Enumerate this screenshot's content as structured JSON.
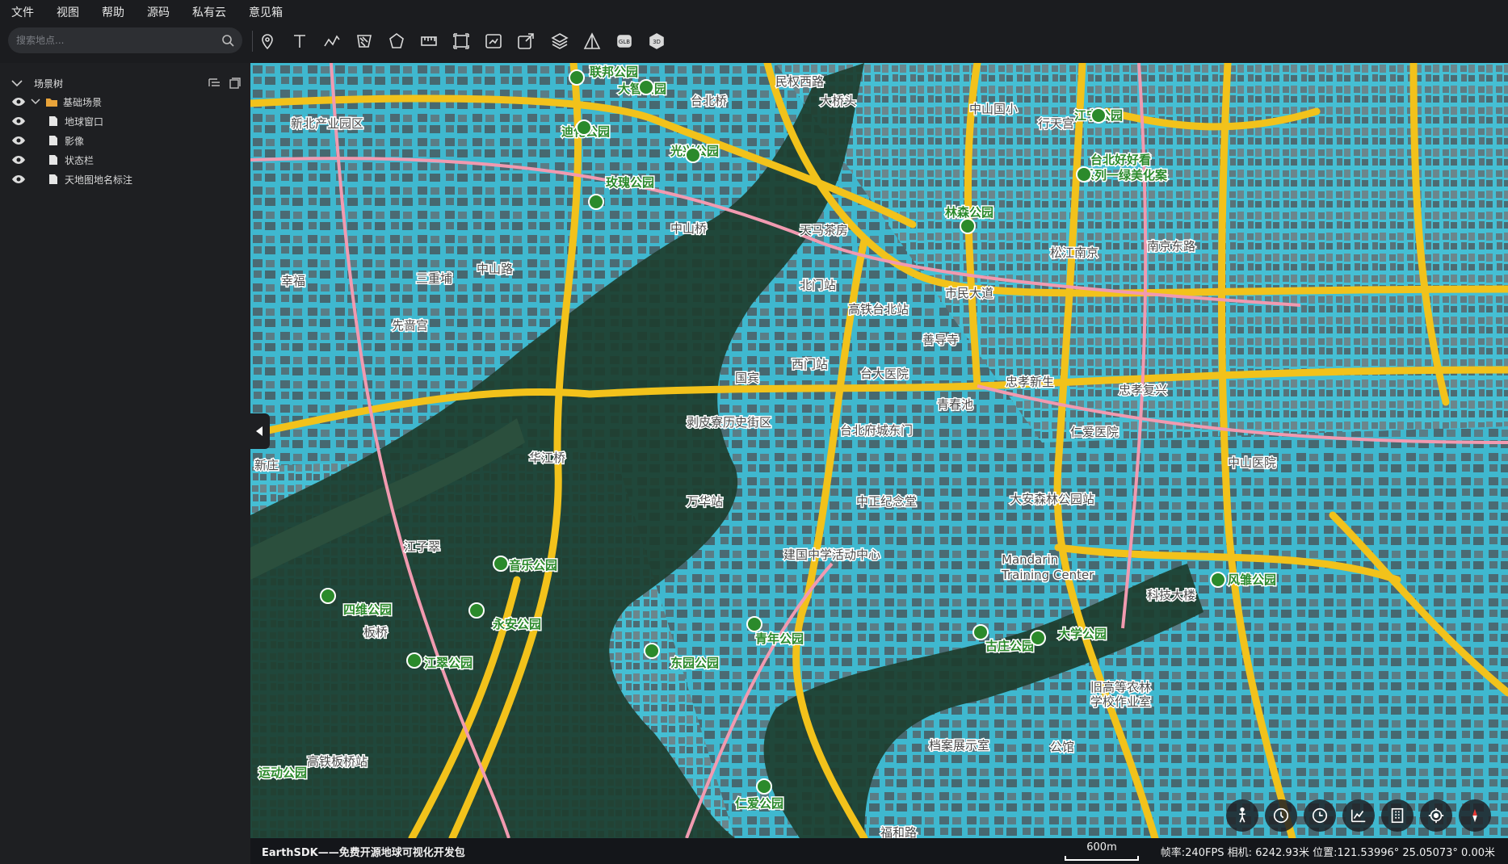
{
  "menu": [
    "文件",
    "视图",
    "帮助",
    "源码",
    "私有云",
    "意见箱"
  ],
  "search": {
    "placeholder": "搜索地点..."
  },
  "toolbar": {
    "tools": [
      "location-pin-icon",
      "text-icon",
      "polyline-icon",
      "polygon-hatch-icon",
      "pentagon-icon",
      "ruler-icon",
      "bounding-box-icon",
      "image-export-icon",
      "share-icon",
      "layers-icon",
      "triangle-icon",
      "glb-icon",
      "3d-icon"
    ]
  },
  "scene_tree": {
    "title": "场景树",
    "root": "基础场景",
    "items": [
      "地球窗口",
      "影像",
      "状态栏",
      "天地图地名标注"
    ]
  },
  "map": {
    "labels_green": [
      "联邦公园",
      "大智公园",
      "迪化公园",
      "光兴公园",
      "玫瑰公园",
      "江宁公园",
      "台北好好看系列一绿美化案",
      "林森公园",
      "音乐公园",
      "四维公园",
      "永安公园",
      "江翠公园",
      "东园公园",
      "青年公园",
      "古庄公园",
      "大学公园",
      "仁爱公园",
      "风雏公园",
      "运动公园"
    ],
    "labels_dark": [
      "民权西路",
      "新北产业园区",
      "台北桥",
      "大桥头",
      "中山国小",
      "行天宫",
      "松江南京",
      "南京东路",
      "天马茶房",
      "北门站",
      "高铁台北站",
      "市民大道",
      "西门站",
      "国宾",
      "台大医院",
      "善导寺",
      "忠孝新生",
      "忠孝复兴",
      "剥皮寮历史街区",
      "台北府城东门",
      "青春池",
      "仁爱医院",
      "中山医院",
      "华江桥",
      "万华站",
      "中正纪念堂",
      "大安森林公园站",
      "建国中学活动中心",
      "Mandarin Training Center",
      "江子翠",
      "板桥",
      "科技大楼",
      "旧高等农林学校作业室",
      "档案展示室",
      "公馆",
      "福和路",
      "高铁板桥站",
      "台北桥",
      "三重埔",
      "先啬宫",
      "幸福",
      "新庄",
      "板桥",
      "中山路",
      "中山桥"
    ],
    "scale": "600m"
  },
  "statusbar": {
    "brand": "EarthSDK——免费开源地球可视化开发包",
    "info": "帧率:240FPS 相机: 6242.93米 位置:121.53996° 25.05073° 0.00米"
  },
  "controls": [
    "person-icon",
    "clock-icon",
    "history-icon",
    "terrain-profile-icon",
    "building-icon",
    "locate-icon",
    "compass-icon"
  ],
  "colors": {
    "water_blue": "#3fb8cf",
    "road_yellow": "#f2c21b",
    "road_pink": "#f19ab0",
    "river": "#1d3d2e",
    "panel": "#1e1f22"
  }
}
